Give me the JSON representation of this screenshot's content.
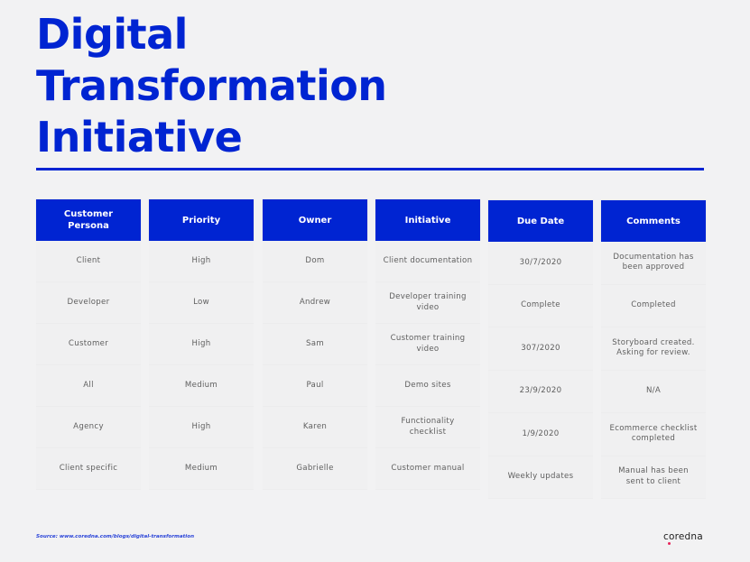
{
  "title_lines": [
    "Digital",
    "Transformation",
    "Initiative"
  ],
  "table": {
    "columns": [
      {
        "header": "Customer Persona",
        "cells": [
          "Client",
          "Developer",
          "Customer",
          "All",
          "Agency",
          "Client specific"
        ]
      },
      {
        "header": "Priority",
        "cells": [
          "High",
          "Low",
          "High",
          "Medium",
          "High",
          "Medium"
        ]
      },
      {
        "header": "Owner",
        "cells": [
          "Dom",
          "Andrew",
          "Sam",
          "Paul",
          "Karen",
          "Gabrielle"
        ]
      },
      {
        "header": "Initiative",
        "cells": [
          "Client documentation",
          "Developer training video",
          "Customer training video",
          "Demo sites",
          "Functionality checklist",
          "Customer manual"
        ]
      },
      {
        "header": "Due Date",
        "cells": [
          "30/7/2020",
          "Complete",
          "307/2020",
          "23/9/2020",
          "1/9/2020",
          "Weekly updates"
        ]
      },
      {
        "header": "Comments",
        "cells": [
          "Documentation has been approved",
          "Completed",
          "Storyboard created. Asking for review.",
          "N/A",
          "Ecommerce checklist completed",
          "Manual has been sent to client"
        ]
      }
    ]
  },
  "footer": {
    "source": "Source: www.coredna.com/blogs/digital-transformation",
    "logo": "coredna"
  },
  "colors": {
    "brand_blue": "#0024d2",
    "background": "#f2f2f3",
    "logo_accent": "#e8245a"
  }
}
